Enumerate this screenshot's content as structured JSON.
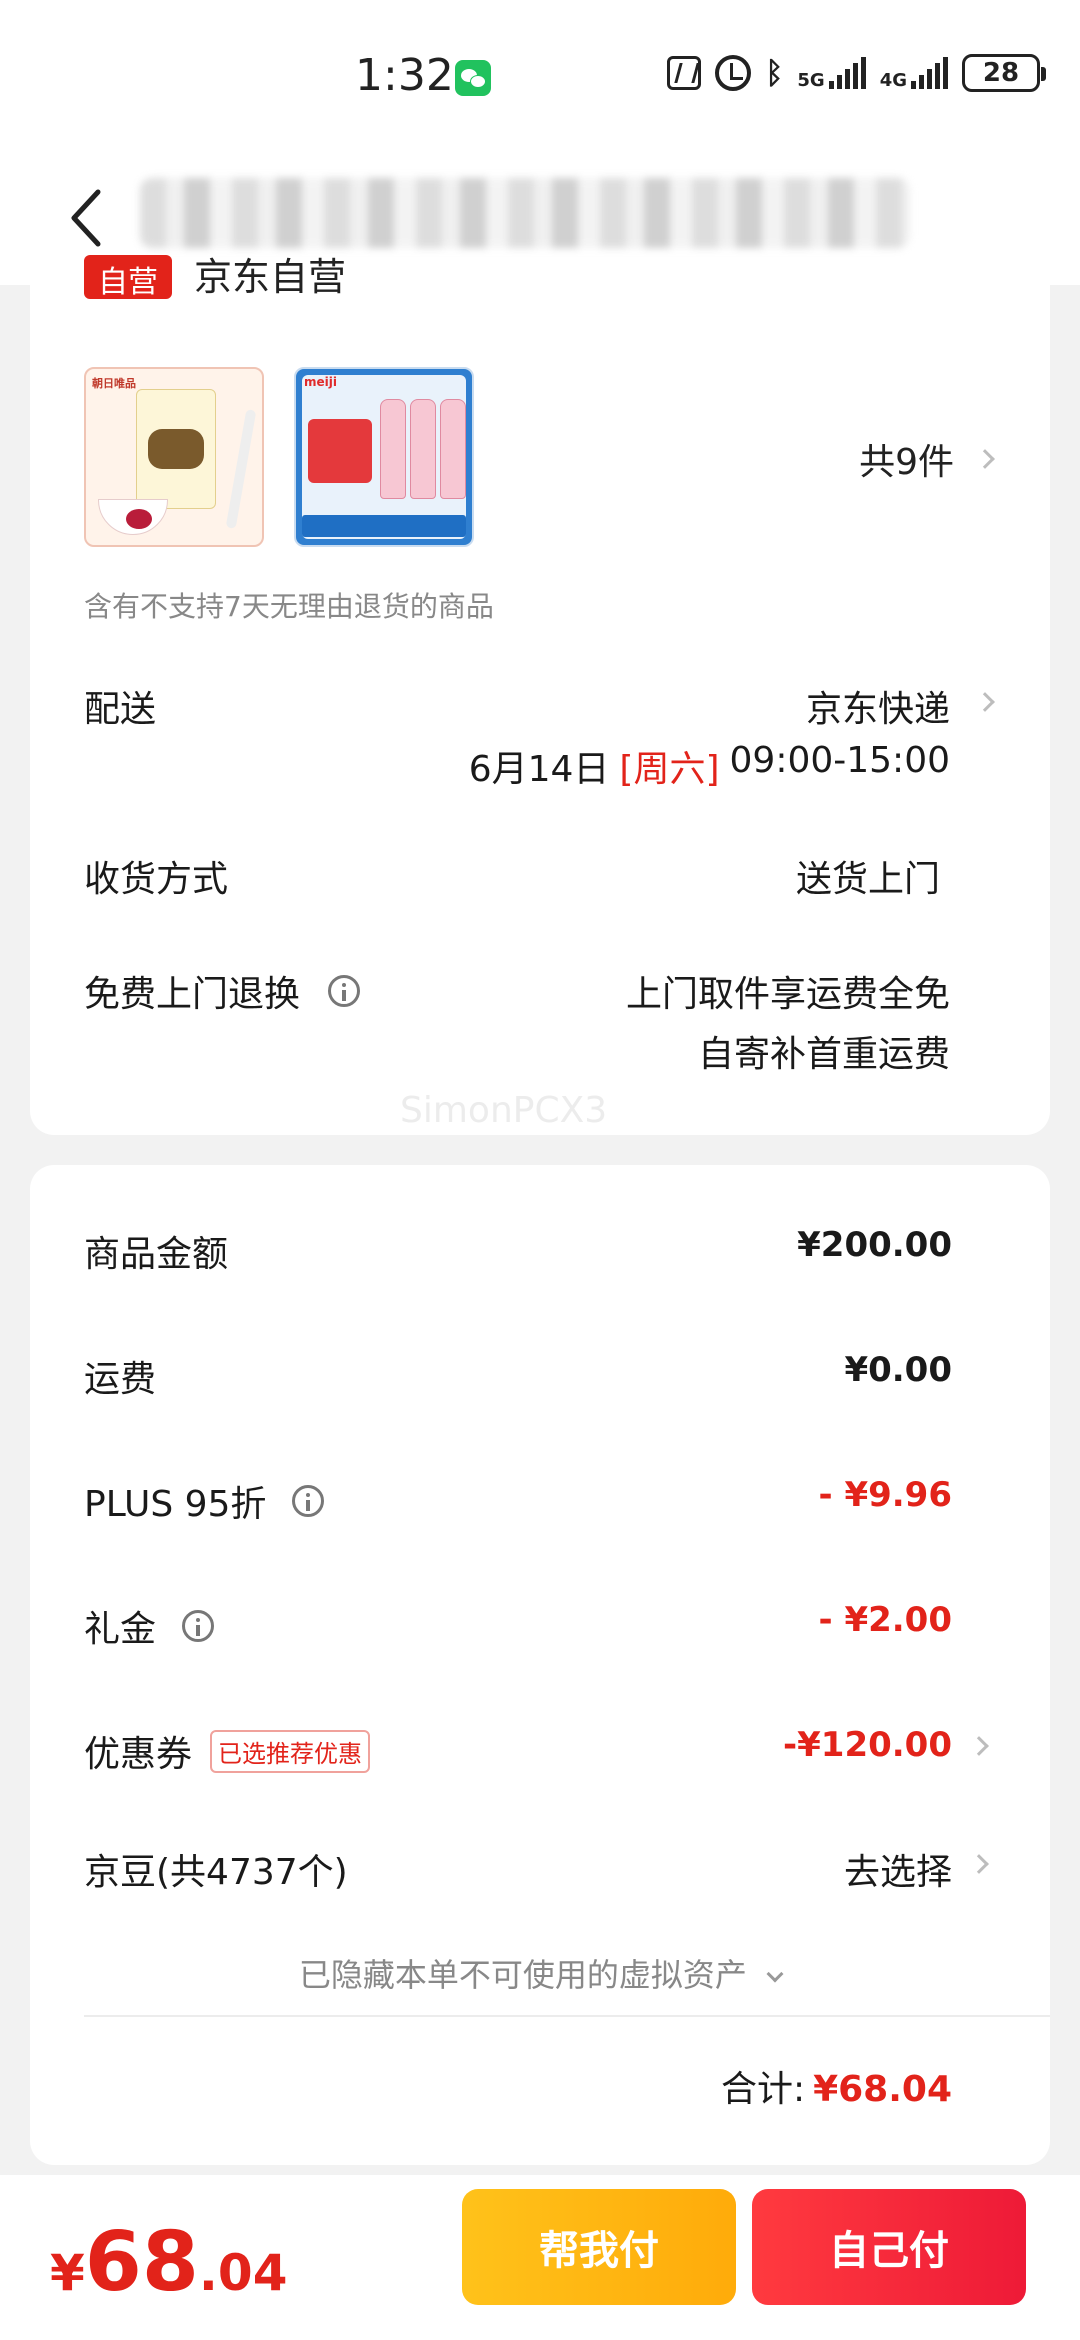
{
  "status_bar": {
    "time": "1:32",
    "signal1_label": "5G",
    "signal2_label": "4G",
    "battery": "28",
    "icons": [
      "wechat-icon",
      "nfc-icon",
      "alarm-icon",
      "bluetooth-icon",
      "signal-icon",
      "battery-icon"
    ]
  },
  "nav": {
    "back_icon": "chevron-left-icon"
  },
  "store": {
    "tag": "自营",
    "name": "京东自营"
  },
  "products": {
    "count_text": "共9件",
    "thumbnails": [
      "product-yogurt-image",
      "product-meiji-drink-image"
    ]
  },
  "notice": "含有不支持7天无理由退货的商品",
  "shipping": {
    "label": "配送",
    "carrier": "京东快递",
    "date": "6月14日",
    "weekday": "[周六]",
    "time_window": "09:00-15:00"
  },
  "receive": {
    "label": "收货方式",
    "value": "送货上门"
  },
  "returns": {
    "label": "免费上门退换",
    "line1": "上门取件享运费全免",
    "line2": "自寄补首重运费"
  },
  "watermark": "SimonPCX3",
  "summary": {
    "goods_label": "商品金额",
    "goods_value": "¥200.00",
    "freight_label": "运费",
    "freight_value": "¥0.00",
    "plus_label": "PLUS 95折",
    "plus_value": "- ¥9.96",
    "gift_label": "礼金",
    "gift_value": "- ¥2.00",
    "coupon_label": "优惠券",
    "coupon_badge": "已选推荐优惠",
    "coupon_value": "-¥120.00",
    "jd_label": "京豆(共4737个)",
    "jd_value": "去选择",
    "hidden_assets": "已隐藏本单不可使用的虚拟资产",
    "total_label": "合计:",
    "total_value": "¥68.04"
  },
  "bottom": {
    "currency": "¥",
    "price_int": "68",
    "price_dec": ".04",
    "help_pay": "帮我付",
    "self_pay": "自己付"
  },
  "colors": {
    "accent_red": "#e2231a",
    "button_yellow": "#ffb312",
    "button_red": "#f2263a"
  }
}
